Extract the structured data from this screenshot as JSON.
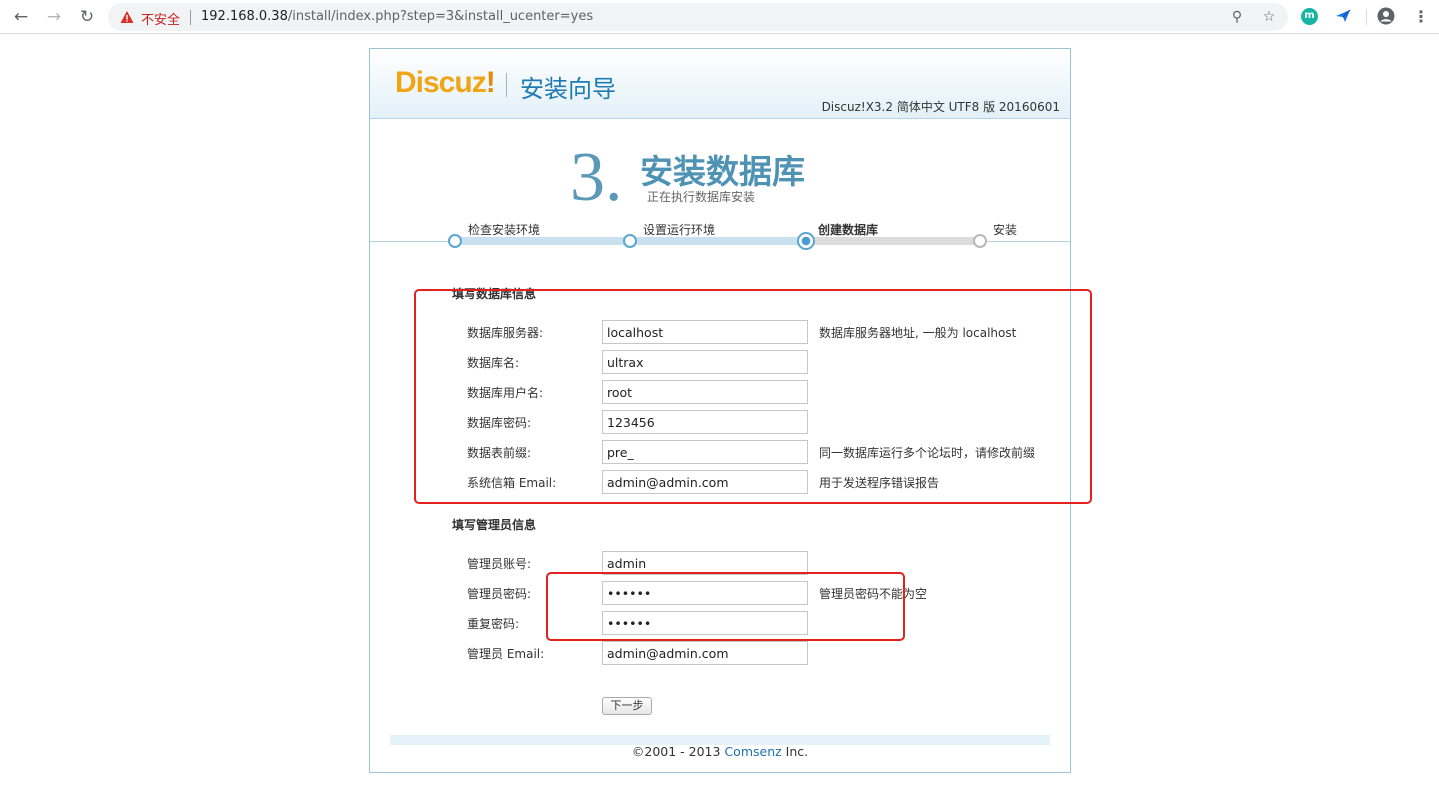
{
  "browser": {
    "insecure_label": "不安全",
    "url_host": "192.168.0.38",
    "url_path": "/install/index.php?step=3&install_ucenter=yes",
    "extension_m_label": "m"
  },
  "header": {
    "logo_text": "Discuz",
    "logo_bang": "!",
    "wizard_title": "安装向导",
    "version": "Discuz!X3.2 简体中文 UTF8 版 20160601"
  },
  "step": {
    "number": "3.",
    "title": "安装数据库",
    "subtitle": "正在执行数据库安装"
  },
  "progress": {
    "completed_fraction": 0.67,
    "steps": [
      {
        "label": "检查安装环境",
        "state": "done"
      },
      {
        "label": "设置运行环境",
        "state": "done"
      },
      {
        "label": "创建数据库",
        "state": "current"
      },
      {
        "label": "安装",
        "state": "todo"
      }
    ]
  },
  "db_section": {
    "title": "填写数据库信息",
    "fields": [
      {
        "label": "数据库服务器:",
        "value": "localhost",
        "note": "数据库服务器地址, 一般为 localhost"
      },
      {
        "label": "数据库名:",
        "value": "ultrax",
        "note": ""
      },
      {
        "label": "数据库用户名:",
        "value": "root",
        "note": ""
      },
      {
        "label": "数据库密码:",
        "value": "123456",
        "note": ""
      },
      {
        "label": "数据表前缀:",
        "value": "pre_",
        "note": "同一数据库运行多个论坛时，请修改前缀"
      },
      {
        "label": "系统信箱 Email:",
        "value": "admin@admin.com",
        "note": "用于发送程序错误报告"
      }
    ]
  },
  "admin_section": {
    "title": "填写管理员信息",
    "fields": [
      {
        "label": "管理员账号:",
        "value": "admin",
        "note": ""
      },
      {
        "label": "管理员密码:",
        "value": "••••••",
        "note": "管理员密码不能为空"
      },
      {
        "label": "重复密码:",
        "value": "••••••",
        "note": ""
      },
      {
        "label": "管理员 Email:",
        "value": "admin@admin.com",
        "note": ""
      }
    ]
  },
  "next_button": "下一步",
  "footer": {
    "prefix": "©2001 - 2013 ",
    "brand": "Comsenz",
    "suffix": " Inc."
  },
  "colors": {
    "annotation_red": "#e2221f",
    "accent_blue": "#4e92b4",
    "logo_orange": "#f1a516"
  }
}
